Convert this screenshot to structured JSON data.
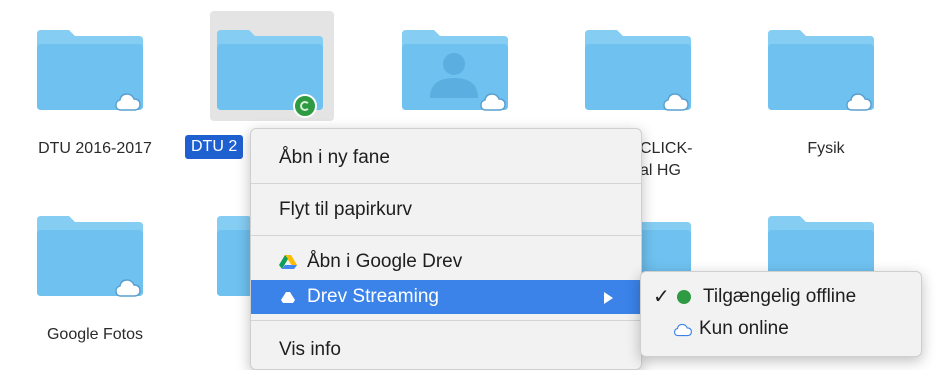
{
  "folders": [
    {
      "label": "DTU 2016-2017"
    },
    {
      "label": "DTU 2"
    },
    {
      "label": ""
    },
    {
      "label": "CLICK-"
    },
    {
      "label": "Fysik"
    },
    {
      "label": "Google Fotos"
    }
  ],
  "folder_label_extra": "al HG",
  "context_menu": {
    "items": [
      {
        "label": "Åbn i ny fane"
      },
      {
        "label": "Flyt til papirkurv"
      },
      {
        "label": "Åbn i Google Drev"
      },
      {
        "label": "Drev Streaming"
      },
      {
        "label": "Vis info"
      }
    ]
  },
  "submenu": {
    "items": [
      {
        "label": "Tilgængelig offline",
        "checked": true
      },
      {
        "label": "Kun online",
        "checked": false
      }
    ]
  },
  "colors": {
    "folder": "#6fc1f0",
    "folder_tab": "#86cdf4",
    "highlight": "#3b83e8",
    "selection": "#1f60d0",
    "sync_green": "#2e9b43"
  },
  "icons": [
    "folder-icon",
    "cloud-icon",
    "sync-check-icon",
    "google-drive-icon",
    "drive-icon",
    "checkmark-icon",
    "submenu-arrow-icon",
    "person-icon"
  ]
}
